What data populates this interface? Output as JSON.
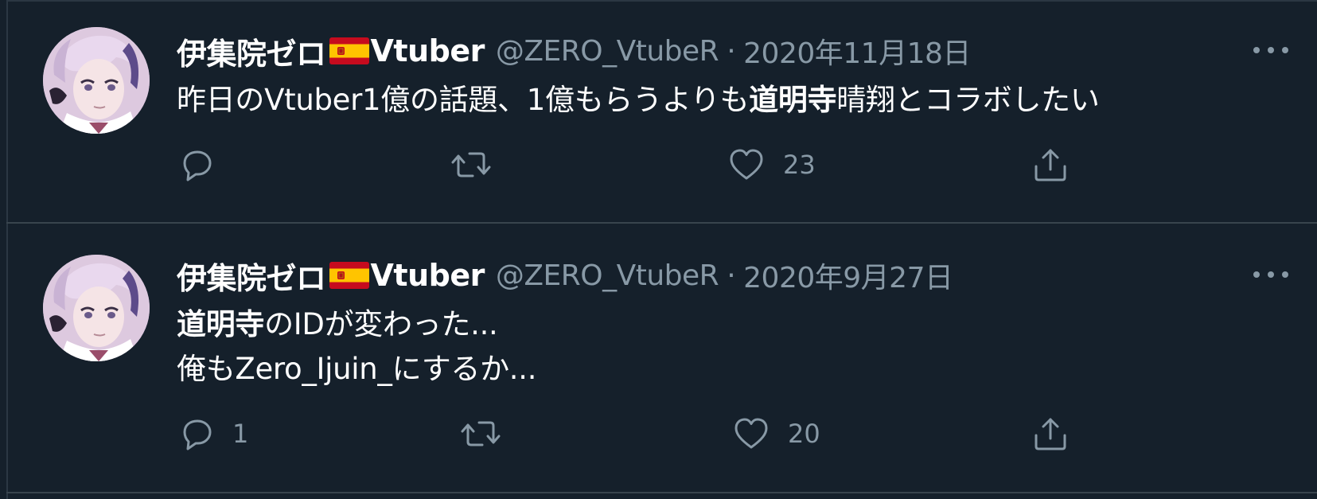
{
  "tweets": [
    {
      "display_name": "伊集院ゼロ",
      "name_suffix": "Vtuber",
      "handle": "@ZERO_VtubeR",
      "separator": "·",
      "date": "2020年11月18日",
      "text_parts": [
        "昨日のVtuber1億の話題、1億もらうよりも",
        "道明寺",
        "晴翔とコラボしたい"
      ],
      "reply_count": "",
      "retweet_count": "",
      "like_count": "23"
    },
    {
      "display_name": "伊集院ゼロ",
      "name_suffix": "Vtuber",
      "handle": "@ZERO_VtubeR",
      "separator": "·",
      "date": "2020年9月27日",
      "text_line1_parts": [
        "道明寺",
        "のIDが変わった..."
      ],
      "text_line2": "俺もZero_Ijuin_にするか...",
      "reply_count": "1",
      "retweet_count": "",
      "like_count": "20"
    }
  ],
  "icons": {
    "flag": "spain-flag-icon",
    "more": "more-options-icon",
    "reply": "reply-icon",
    "retweet": "retweet-icon",
    "like": "heart-icon",
    "share": "share-icon"
  },
  "colors": {
    "background": "#15202b",
    "divider": "#38444d",
    "text_primary": "#ffffff",
    "text_secondary": "#8899a6"
  }
}
